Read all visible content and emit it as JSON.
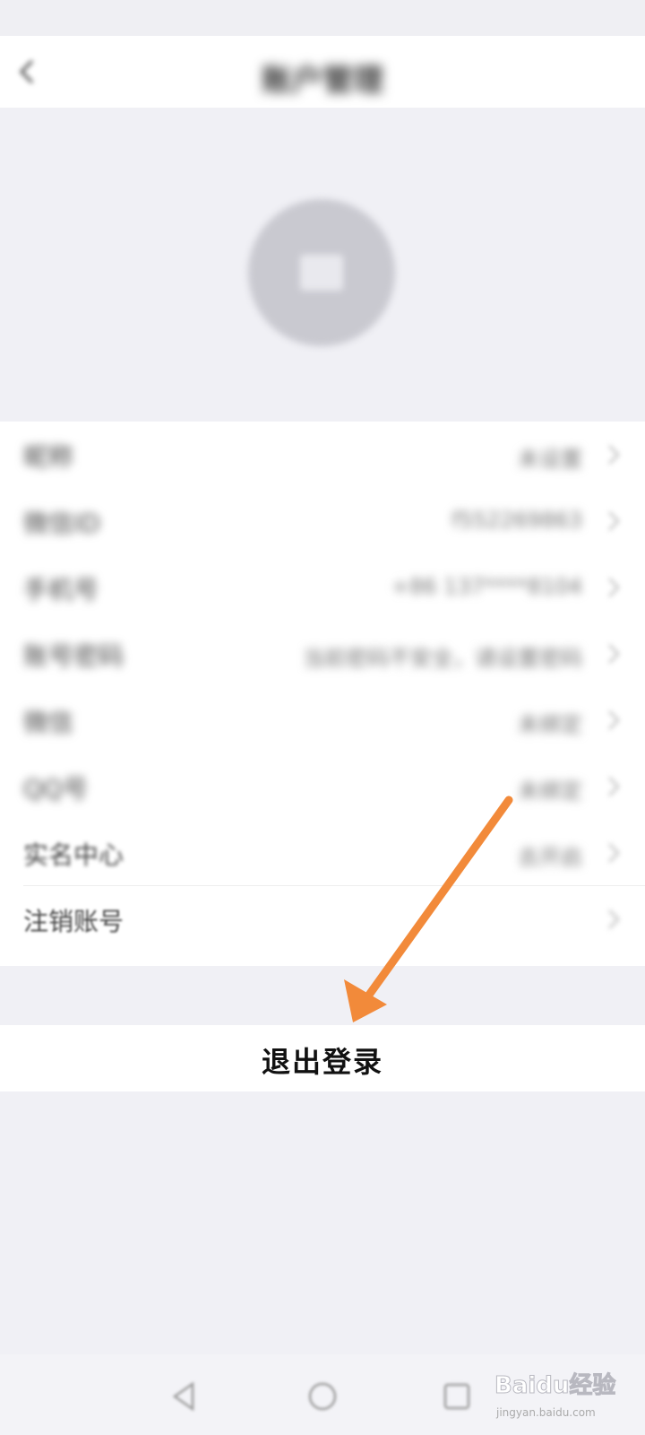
{
  "nav": {
    "title": "账户管理"
  },
  "rows": [
    {
      "label": "昵称",
      "value": "未设置"
    },
    {
      "label": "微信ID",
      "value": "f552269863"
    },
    {
      "label": "手机号",
      "value": "+86 137****8104"
    },
    {
      "label": "账号密码",
      "value": "当前密码不安全，请设置密码"
    },
    {
      "label": "微信",
      "value": "未绑定"
    },
    {
      "label": "QQ号",
      "value": "未绑定"
    },
    {
      "label": "实名中心",
      "value": "去开启"
    },
    {
      "label": "注销账号",
      "value": ""
    }
  ],
  "logout": {
    "label": "退出登录"
  },
  "watermark": {
    "logo": "Baidu经验",
    "url": "jingyan.baidu.com"
  },
  "colors": {
    "arrow": "#f28a3a",
    "background": "#f0f0f5"
  }
}
